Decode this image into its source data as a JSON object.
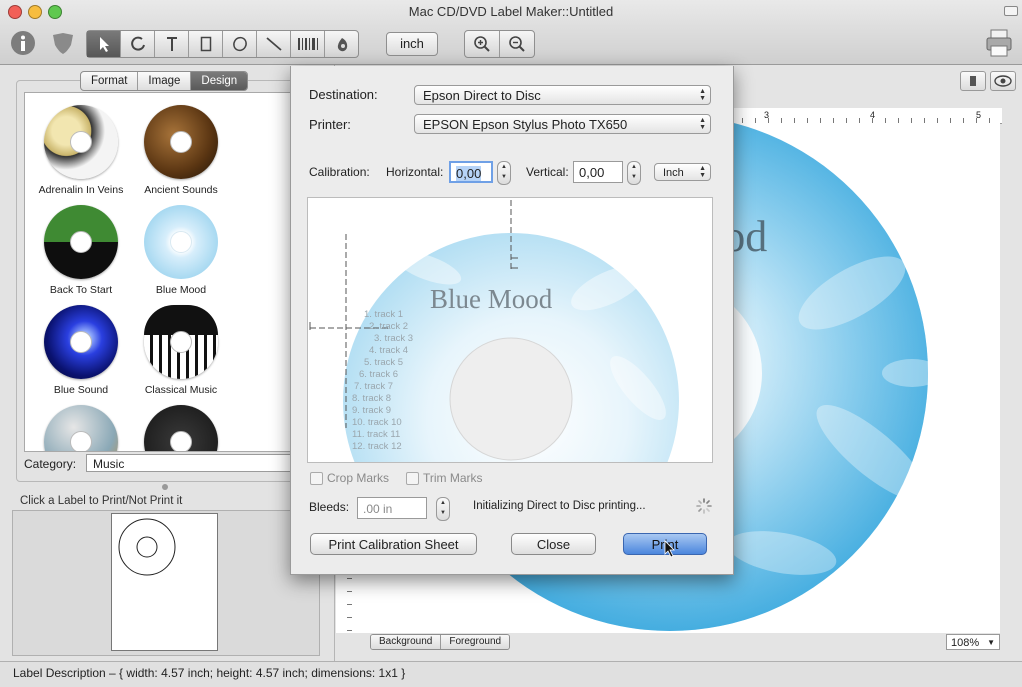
{
  "window": {
    "title": "Mac CD/DVD Label Maker::Untitled"
  },
  "toolbar": {
    "unit_label": "inch",
    "tools": [
      "select-tool",
      "curve-tool",
      "text-tool",
      "rectangle-tool",
      "ellipse-tool",
      "line-tool",
      "barcode-tool",
      "fill-tool"
    ],
    "info_icon": "info-icon",
    "shield_icon": "shield-icon",
    "zoom_in_icon": "zoom-in-icon",
    "zoom_out_icon": "zoom-out-icon",
    "printer_icon": "printer-icon"
  },
  "left_panel": {
    "tabs": [
      {
        "label": "Format",
        "selected": false
      },
      {
        "label": "Image",
        "selected": false
      },
      {
        "label": "Design",
        "selected": true
      }
    ],
    "gallery": [
      {
        "label": "Adrenalin In Veins",
        "colors": [
          "#e8d68f",
          "#3b3b3b"
        ]
      },
      {
        "label": "Ancient Sounds",
        "colors": [
          "#7a4b1e",
          "#2a1a0a"
        ]
      },
      {
        "label": "Back To Start",
        "colors": [
          "#3c7a2e",
          "#111111"
        ]
      },
      {
        "label": "Blue Mood",
        "colors": [
          "#d8eefb",
          "#9ccfe9"
        ]
      },
      {
        "label": "Blue Sound",
        "colors": [
          "#1a2fbf",
          "#050a40"
        ]
      },
      {
        "label": "Classical Music",
        "colors": [
          "#111111",
          "#444444"
        ]
      },
      {
        "label": "",
        "colors": [
          "#c9c9c9",
          "#6e8f9f"
        ]
      },
      {
        "label": "",
        "colors": [
          "#222222",
          "#555555"
        ]
      }
    ],
    "category_label": "Category:",
    "category_value": "Music",
    "click_hint": "Click a Label to Print/Not Print it"
  },
  "status": {
    "description": "Label Description – { width: 4.57 inch; height: 4.57 inch; dimensions: 1x1 }"
  },
  "canvas": {
    "disc_title": "Blue Mood",
    "ruler_marks": [
      "3",
      "4",
      "5"
    ],
    "layer_tabs": [
      "Background",
      "Foreground"
    ],
    "zoom": "108%"
  },
  "dialog": {
    "destination_label": "Destination:",
    "destination_value": "Epson Direct to Disc",
    "printer_label": "Printer:",
    "printer_value": "EPSON Epson Stylus Photo TX650",
    "calibration_label": "Calibration:",
    "horizontal_label": "Horizontal:",
    "horizontal_value": "0,00",
    "vertical_label": "Vertical:",
    "vertical_value": "0,00",
    "unit_value": "Inch",
    "preview_title": "Blue Mood",
    "tracks": [
      "1. track 1",
      "2. track 2",
      "3. track 3",
      "4. track 4",
      "5. track 5",
      "6. track 6",
      "7. track 7",
      "8. track 8",
      "9. track 9",
      "10. track 10",
      "11. track 11",
      "12. track 12"
    ],
    "crop_marks_label": "Crop Marks",
    "trim_marks_label": "Trim Marks",
    "bleeds_label": "Bleeds:",
    "bleeds_value": ".00 in",
    "status_text": "Initializing Direct to Disc printing...",
    "calib_sheet_button": "Print Calibration Sheet",
    "close_button": "Close",
    "print_button": "Print"
  }
}
